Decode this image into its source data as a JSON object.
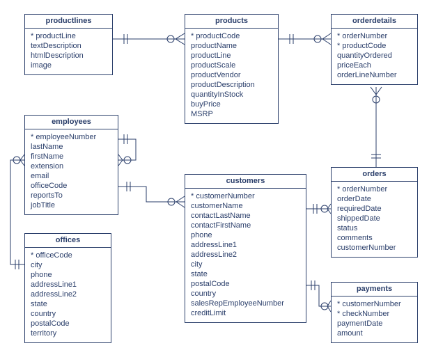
{
  "entities": {
    "productlines": {
      "title": "productlines",
      "fields": [
        {
          "name": "productLine",
          "pk": true
        },
        {
          "name": "textDescription",
          "pk": false
        },
        {
          "name": "htmlDescription",
          "pk": false
        },
        {
          "name": "image",
          "pk": false
        }
      ]
    },
    "products": {
      "title": "products",
      "fields": [
        {
          "name": "productCode",
          "pk": true
        },
        {
          "name": "productName",
          "pk": false
        },
        {
          "name": "productLine",
          "pk": false
        },
        {
          "name": "productScale",
          "pk": false
        },
        {
          "name": "productVendor",
          "pk": false
        },
        {
          "name": "productDescription",
          "pk": false
        },
        {
          "name": "quantityInStock",
          "pk": false
        },
        {
          "name": "buyPrice",
          "pk": false
        },
        {
          "name": "MSRP",
          "pk": false
        }
      ]
    },
    "orderdetails": {
      "title": "orderdetails",
      "fields": [
        {
          "name": "orderNumber",
          "pk": true
        },
        {
          "name": "productCode",
          "pk": true
        },
        {
          "name": "quantityOrdered",
          "pk": false
        },
        {
          "name": "priceEach",
          "pk": false
        },
        {
          "name": "orderLineNumber",
          "pk": false
        }
      ]
    },
    "employees": {
      "title": "employees",
      "fields": [
        {
          "name": "employeeNumber",
          "pk": true
        },
        {
          "name": "lastName",
          "pk": false
        },
        {
          "name": "firstName",
          "pk": false
        },
        {
          "name": "extension",
          "pk": false
        },
        {
          "name": "email",
          "pk": false
        },
        {
          "name": "officeCode",
          "pk": false
        },
        {
          "name": "reportsTo",
          "pk": false
        },
        {
          "name": "jobTitle",
          "pk": false
        }
      ]
    },
    "customers": {
      "title": "customers",
      "fields": [
        {
          "name": "customerNumber",
          "pk": true
        },
        {
          "name": "customerName",
          "pk": false
        },
        {
          "name": "contactLastName",
          "pk": false
        },
        {
          "name": "contactFirstName",
          "pk": false
        },
        {
          "name": "phone",
          "pk": false
        },
        {
          "name": "addressLine1",
          "pk": false
        },
        {
          "name": "addressLine2",
          "pk": false
        },
        {
          "name": "city",
          "pk": false
        },
        {
          "name": "state",
          "pk": false
        },
        {
          "name": "postalCode",
          "pk": false
        },
        {
          "name": "country",
          "pk": false
        },
        {
          "name": "salesRepEmployeeNumber",
          "pk": false
        },
        {
          "name": "creditLimit",
          "pk": false
        }
      ]
    },
    "orders": {
      "title": "orders",
      "fields": [
        {
          "name": "orderNumber",
          "pk": true
        },
        {
          "name": "orderDate",
          "pk": false
        },
        {
          "name": "requiredDate",
          "pk": false
        },
        {
          "name": "shippedDate",
          "pk": false
        },
        {
          "name": "status",
          "pk": false
        },
        {
          "name": "comments",
          "pk": false
        },
        {
          "name": "customerNumber",
          "pk": false
        }
      ]
    },
    "offices": {
      "title": "offices",
      "fields": [
        {
          "name": "officeCode",
          "pk": true
        },
        {
          "name": "city",
          "pk": false
        },
        {
          "name": "phone",
          "pk": false
        },
        {
          "name": "addressLine1",
          "pk": false
        },
        {
          "name": "addressLine2",
          "pk": false
        },
        {
          "name": "state",
          "pk": false
        },
        {
          "name": "country",
          "pk": false
        },
        {
          "name": "postalCode",
          "pk": false
        },
        {
          "name": "territory",
          "pk": false
        }
      ]
    },
    "payments": {
      "title": "payments",
      "fields": [
        {
          "name": "customerNumber",
          "pk": true
        },
        {
          "name": "checkNumber",
          "pk": true
        },
        {
          "name": "paymentDate",
          "pk": false
        },
        {
          "name": "amount",
          "pk": false
        }
      ]
    }
  }
}
